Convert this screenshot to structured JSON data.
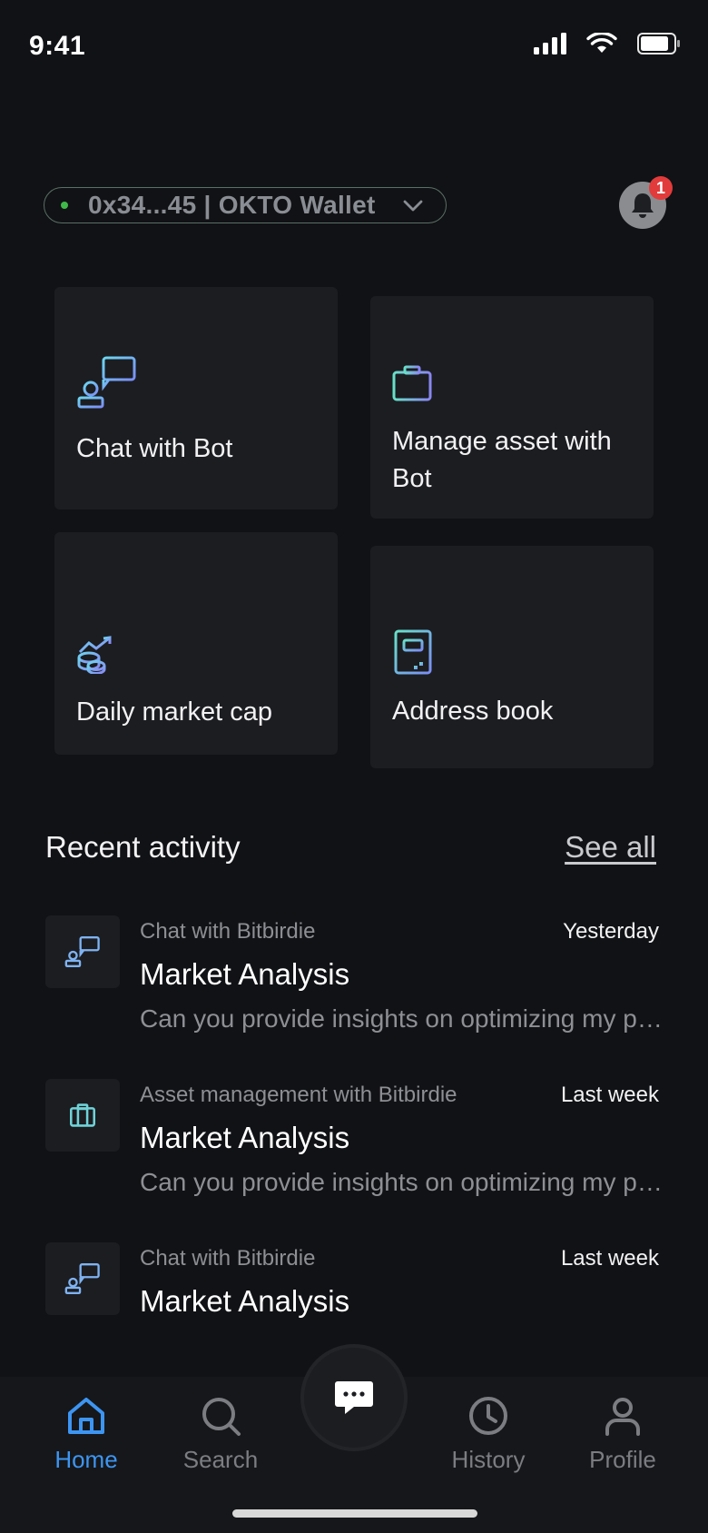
{
  "status_bar": {
    "time": "9:41"
  },
  "wallet": {
    "label": "0x34...45 | OKTO Wallet"
  },
  "notifications": {
    "badge_count": "1"
  },
  "cards": [
    {
      "label": "Chat with Bot",
      "icon": "chat-bot-icon"
    },
    {
      "label": "Manage asset with Bot",
      "icon": "briefcase-icon"
    },
    {
      "label": "Daily market cap",
      "icon": "coins-growth-icon"
    },
    {
      "label": "Address book",
      "icon": "address-book-icon"
    }
  ],
  "recent": {
    "title": "Recent activity",
    "see_all": "See all",
    "items": [
      {
        "source": "Chat with Bitbirdie",
        "time": "Yesterday",
        "title": "Market Analysis",
        "preview": "Can you provide insights on optimizing my portfolio",
        "icon": "chat-bot-icon"
      },
      {
        "source": "Asset management with Bitbirdie",
        "time": "Last week",
        "title": "Market Analysis",
        "preview": "Can you provide insights on optimizing my portfolio",
        "icon": "briefcase-icon"
      },
      {
        "source": "Chat with Bitbirdie",
        "time": "Last week",
        "title": "Market Analysis",
        "preview": "",
        "icon": "chat-bot-icon"
      }
    ]
  },
  "tabs": [
    {
      "label": "Home",
      "icon": "home-icon",
      "active": true
    },
    {
      "label": "Search",
      "icon": "search-icon",
      "active": false
    },
    {
      "label": "",
      "icon": "chat-bubble-icon",
      "active": false
    },
    {
      "label": "History",
      "icon": "clock-icon",
      "active": false
    },
    {
      "label": "Profile",
      "icon": "user-icon",
      "active": false
    }
  ],
  "colors": {
    "background": "#111215",
    "card": "#1c1d21",
    "accent": "#3d95f2",
    "badge": "#e23b3b",
    "online": "#3fb94a"
  }
}
